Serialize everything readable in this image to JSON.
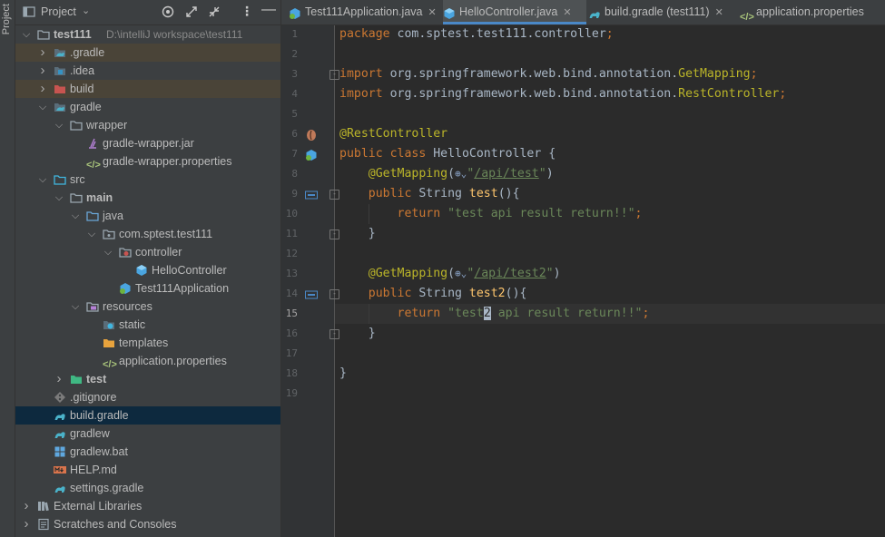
{
  "sidebar_stripe": {
    "label": "Project"
  },
  "project_panel": {
    "title": "Project",
    "tree": [
      {
        "label": "test111",
        "path": "D:\\intelliJ workspace\\test111",
        "icon": "folder-icon",
        "depth": 0,
        "expanded": true,
        "bold": true
      },
      {
        "label": ".gradle",
        "icon": "folder-gradle-icon",
        "depth": 1,
        "expanded": false,
        "highlight": "brown"
      },
      {
        "label": ".idea",
        "icon": "folder-idea-icon",
        "depth": 1,
        "expanded": false
      },
      {
        "label": "build",
        "icon": "folder-build-icon",
        "depth": 1,
        "expanded": false,
        "highlight": "brown"
      },
      {
        "label": "gradle",
        "icon": "folder-gradle-icon",
        "depth": 1,
        "expanded": true
      },
      {
        "label": "wrapper",
        "icon": "folder-icon",
        "depth": 2,
        "expanded": true
      },
      {
        "label": "gradle-wrapper.jar",
        "icon": "jar-icon",
        "depth": 3
      },
      {
        "label": "gradle-wrapper.properties",
        "icon": "properties-icon",
        "depth": 3
      },
      {
        "label": "src",
        "icon": "folder-src-icon",
        "depth": 1,
        "expanded": true
      },
      {
        "label": "main",
        "icon": "folder-icon",
        "depth": 2,
        "expanded": true,
        "bold": true
      },
      {
        "label": "java",
        "icon": "folder-java-icon",
        "depth": 3,
        "expanded": true
      },
      {
        "label": "com.sptest.test111",
        "icon": "package-icon",
        "depth": 4,
        "expanded": true
      },
      {
        "label": "controller",
        "icon": "package-controller-icon",
        "depth": 5,
        "expanded": true
      },
      {
        "label": "HelloController",
        "icon": "class-icon",
        "depth": 6
      },
      {
        "label": "Test111Application",
        "icon": "spring-class-icon",
        "depth": 5
      },
      {
        "label": "resources",
        "icon": "folder-resources-icon",
        "depth": 3,
        "expanded": true
      },
      {
        "label": "static",
        "icon": "folder-web-icon",
        "depth": 4
      },
      {
        "label": "templates",
        "icon": "folder-yellow-icon",
        "depth": 4
      },
      {
        "label": "application.properties",
        "icon": "properties-icon",
        "depth": 4
      },
      {
        "label": "test",
        "icon": "folder-test-icon",
        "depth": 2,
        "expanded": false,
        "bold": true
      },
      {
        "label": ".gitignore",
        "icon": "gitignore-icon",
        "depth": 1
      },
      {
        "label": "build.gradle",
        "icon": "gradle-icon",
        "depth": 1,
        "selected": true
      },
      {
        "label": "gradlew",
        "icon": "gradle-icon",
        "depth": 1
      },
      {
        "label": "gradlew.bat",
        "icon": "windows-icon",
        "depth": 1
      },
      {
        "label": "HELP.md",
        "icon": "markdown-icon",
        "depth": 1
      },
      {
        "label": "settings.gradle",
        "icon": "gradle-icon",
        "depth": 1
      },
      {
        "label": "External Libraries",
        "icon": "libraries-icon",
        "depth": 0,
        "expanded": false
      },
      {
        "label": "Scratches and Consoles",
        "icon": "scratches-icon",
        "depth": 0,
        "expanded": false
      }
    ]
  },
  "tabs": [
    {
      "label": "Test111Application.java",
      "icon": "spring-class-icon",
      "active": false
    },
    {
      "label": "HelloController.java",
      "icon": "class-icon",
      "active": true
    },
    {
      "label": "build.gradle (test111)",
      "icon": "gradle-icon",
      "active": false
    },
    {
      "label": "application.properties",
      "icon": "properties-icon",
      "active": false
    }
  ],
  "editor": {
    "line_numbers": [
      "1",
      "2",
      "3",
      "4",
      "5",
      "6",
      "7",
      "8",
      "9",
      "10",
      "11",
      "12",
      "13",
      "14",
      "15",
      "16",
      "17",
      "18",
      "19"
    ],
    "current_line": 15,
    "colors": {
      "keyword": "#cc7832",
      "annotation": "#bbb529",
      "string": "#6a8759",
      "method": "#ffc66d",
      "text": "#a9b7c6"
    },
    "code": [
      {
        "n": 1,
        "tokens": [
          [
            "kw",
            "package "
          ],
          [
            "t",
            "com.sptest.test111.controller"
          ],
          [
            "kw",
            ";"
          ]
        ]
      },
      {
        "n": 2,
        "tokens": []
      },
      {
        "n": 3,
        "tokens": [
          [
            "kw",
            "import "
          ],
          [
            "t",
            "org.springframework.web.bind.annotation."
          ],
          [
            "ann",
            "GetMapping"
          ],
          [
            "kw",
            ";"
          ]
        ]
      },
      {
        "n": 4,
        "tokens": [
          [
            "kw",
            "import "
          ],
          [
            "t",
            "org.springframework.web.bind.annotation."
          ],
          [
            "ann",
            "RestController"
          ],
          [
            "kw",
            ";"
          ]
        ]
      },
      {
        "n": 5,
        "tokens": []
      },
      {
        "n": 6,
        "tokens": [
          [
            "ann",
            "@RestController"
          ]
        ]
      },
      {
        "n": 7,
        "tokens": [
          [
            "kw",
            "public class "
          ],
          [
            "t",
            "HelloController {"
          ]
        ]
      },
      {
        "n": 8,
        "tokens": [
          [
            "t",
            "    "
          ],
          [
            "ann",
            "@GetMapping"
          ],
          [
            "t",
            "("
          ],
          [
            "icon",
            "⊕⌄"
          ],
          [
            "str",
            "\""
          ],
          [
            "url",
            "/api/test"
          ],
          [
            "str",
            "\""
          ],
          [
            "t",
            ")"
          ]
        ]
      },
      {
        "n": 9,
        "tokens": [
          [
            "t",
            "    "
          ],
          [
            "kw",
            "public "
          ],
          [
            "t",
            "String "
          ],
          [
            "fn",
            "test"
          ],
          [
            "t",
            "(){"
          ]
        ]
      },
      {
        "n": 10,
        "tokens": [
          [
            "t",
            "        "
          ],
          [
            "kw",
            "return "
          ],
          [
            "str",
            "\"test api result return!!\""
          ],
          [
            "kw",
            ";"
          ]
        ]
      },
      {
        "n": 11,
        "tokens": [
          [
            "t",
            "    }"
          ]
        ]
      },
      {
        "n": 12,
        "tokens": []
      },
      {
        "n": 13,
        "tokens": [
          [
            "t",
            "    "
          ],
          [
            "ann",
            "@GetMapping"
          ],
          [
            "t",
            "("
          ],
          [
            "icon",
            "⊕⌄"
          ],
          [
            "str",
            "\""
          ],
          [
            "url",
            "/api/test2"
          ],
          [
            "str",
            "\""
          ],
          [
            "t",
            ")"
          ]
        ]
      },
      {
        "n": 14,
        "tokens": [
          [
            "t",
            "    "
          ],
          [
            "kw",
            "public "
          ],
          [
            "t",
            "String "
          ],
          [
            "fn",
            "test2"
          ],
          [
            "t",
            "(){"
          ]
        ]
      },
      {
        "n": 15,
        "tokens": [
          [
            "t",
            "        "
          ],
          [
            "kw",
            "return "
          ],
          [
            "str",
            "\"test"
          ],
          [
            "caret",
            "2"
          ],
          [
            "str",
            " api result return!!\""
          ],
          [
            "kw",
            ";"
          ]
        ]
      },
      {
        "n": 16,
        "tokens": [
          [
            "t",
            "    }"
          ]
        ]
      },
      {
        "n": 17,
        "tokens": []
      },
      {
        "n": 18,
        "tokens": [
          [
            "t",
            "}"
          ]
        ]
      },
      {
        "n": 19,
        "tokens": []
      }
    ]
  }
}
